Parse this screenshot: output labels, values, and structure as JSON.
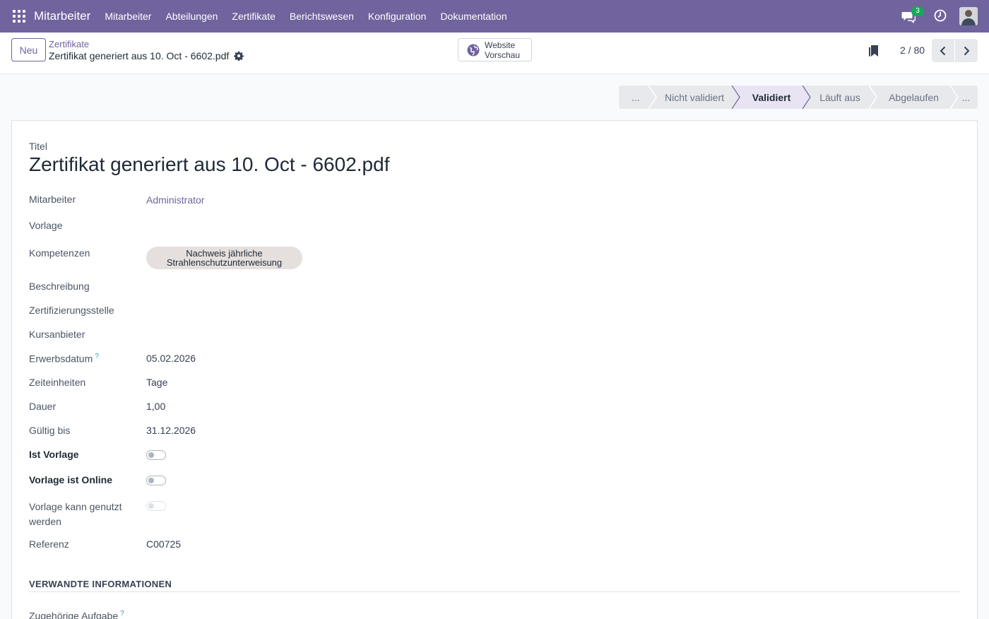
{
  "navbar": {
    "app_name": "Mitarbeiter",
    "menu": [
      "Mitarbeiter",
      "Abteilungen",
      "Zertifikate",
      "Berichtswesen",
      "Konfiguration",
      "Dokumentation"
    ],
    "chat_badge": "3",
    "accent_color": "#71639e"
  },
  "control": {
    "new_label": "Neu",
    "breadcrumb_parent": "Zertifikate",
    "breadcrumb_current": "Zertifikat generiert aus 10. Oct - 6602.pdf",
    "website_line1": "Website",
    "website_line2": "Vorschau",
    "pager": "2 / 80"
  },
  "status": {
    "stages": [
      "...",
      "Nicht validiert",
      "Validiert",
      "Läuft aus",
      "Abgelaufen",
      "..."
    ],
    "active": "Validiert"
  },
  "form": {
    "title_label": "Titel",
    "title_value": "Zertifikat generiert aus 10. Oct - 6602.pdf",
    "fields": {
      "mitarbeiter_label": "Mitarbeiter",
      "mitarbeiter_value": "Administrator",
      "vorlage_label": "Vorlage",
      "kompetenzen_label": "Kompetenzen",
      "kompetenz_tag_line1": "Nachweis jährliche",
      "kompetenz_tag_line2": "Strahlenschutzunterweisung",
      "beschreibung_label": "Beschreibung",
      "zertifizierungsstelle_label": "Zertifizierungsstelle",
      "kursanbieter_label": "Kursanbieter",
      "erwerbsdatum_label": "Erwerbsdatum",
      "erwerbsdatum_value": "05.02.2026",
      "help_mark": "?",
      "zeiteinheiten_label": "Zeiteinheiten",
      "zeiteinheiten_value": "Tage",
      "dauer_label": "Dauer",
      "dauer_value": "1,00",
      "gueltig_bis_label": "Gültig bis",
      "gueltig_bis_value": "31.12.2026",
      "ist_vorlage_label": "Ist Vorlage",
      "vorlage_online_label": "Vorlage ist Online",
      "vorlage_genutzt_line1": "Vorlage kann genutzt",
      "vorlage_genutzt_line2": "werden",
      "referenz_label": "Referenz",
      "referenz_value": "C00725"
    },
    "section_title": "VERWANDTE INFORMATIONEN",
    "zugehoerige_aufgabe_label": "Zugehörige Aufgabe"
  }
}
